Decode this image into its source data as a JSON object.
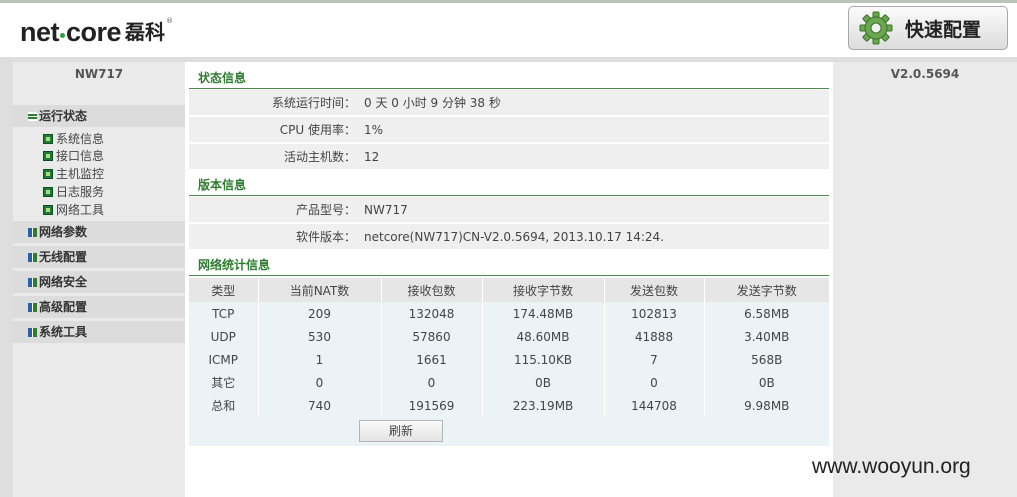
{
  "brand": {
    "logo_en_1": "net",
    "logo_en_2": "core",
    "logo_cn": "磊科",
    "reg_mark": "®"
  },
  "header": {
    "quick_config_label": "快速配置"
  },
  "sidebar": {
    "model": "NW717",
    "sections": [
      {
        "label": "运行状态",
        "items": [
          "系统信息",
          "接口信息",
          "主机监控",
          "日志服务",
          "网络工具"
        ]
      },
      {
        "label": "网络参数"
      },
      {
        "label": "无线配置"
      },
      {
        "label": "网络安全"
      },
      {
        "label": "高级配置"
      },
      {
        "label": "系统工具"
      }
    ]
  },
  "right_panel": {
    "version": "V2.0.5694"
  },
  "status_info": {
    "title": "状态信息",
    "rows": [
      {
        "label": "系统运行时间：",
        "value": "0 天 0 小时 9 分钟 38 秒"
      },
      {
        "label": "CPU 使用率：",
        "value": "1%"
      },
      {
        "label": "活动主机数：",
        "value": "12"
      }
    ]
  },
  "version_info": {
    "title": "版本信息",
    "rows": [
      {
        "label": "产品型号：",
        "value": "NW717"
      },
      {
        "label": "软件版本：",
        "value": "netcore(NW717)CN-V2.0.5694, 2013.10.17 14:24."
      }
    ]
  },
  "net_stats": {
    "title": "网络统计信息",
    "columns": [
      "类型",
      "当前NAT数",
      "接收包数",
      "接收字节数",
      "发送包数",
      "发送字节数"
    ],
    "rows": [
      [
        "TCP",
        "209",
        "132048",
        "174.48MB",
        "102813",
        "6.58MB"
      ],
      [
        "UDP",
        "530",
        "57860",
        "48.60MB",
        "41888",
        "3.40MB"
      ],
      [
        "ICMP",
        "1",
        "1661",
        "115.10KB",
        "7",
        "568B"
      ],
      [
        "其它",
        "0",
        "0",
        "0B",
        "0",
        "0B"
      ],
      [
        "总和",
        "740",
        "191569",
        "223.19MB",
        "144708",
        "9.98MB"
      ]
    ],
    "refresh_label": "刷新"
  },
  "watermark": "www.wooyun.org",
  "colors": {
    "accent_green": "#2f7b2f",
    "section_line": "#4e8a4e",
    "gear_green": "#6aa84f"
  }
}
